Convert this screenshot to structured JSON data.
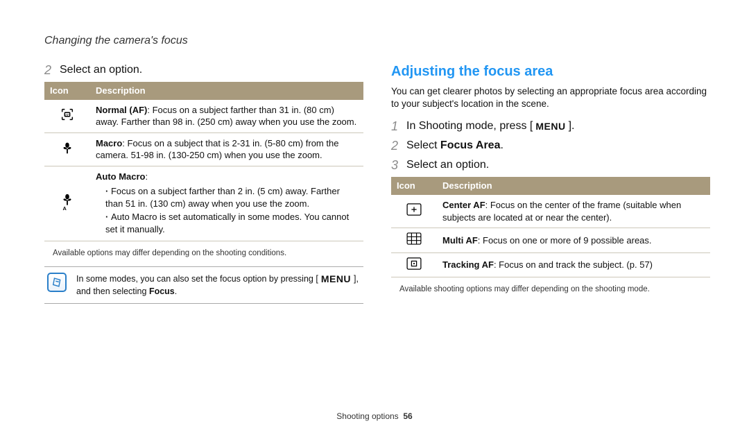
{
  "breadcrumb": "Changing the camera's focus",
  "left": {
    "step_num": "2",
    "step_text": "Select an option.",
    "table": {
      "headers": [
        "Icon",
        "Description"
      ],
      "rows": [
        {
          "icon": "normal-af",
          "title": "Normal (AF)",
          "body": ": Focus on a subject farther than 31 in. (80 cm) away. Farther than 98 in. (250 cm) away when you use the zoom."
        },
        {
          "icon": "macro",
          "title": "Macro",
          "body": ": Focus on a subject that is 2-31 in. (5-80 cm) from the camera. 51-98 in. (130-250 cm) when you use the zoom."
        },
        {
          "icon": "auto-macro",
          "title": "Auto Macro",
          "body": ":",
          "bullets": [
            "Focus on a subject farther than 2 in. (5 cm) away. Farther than 51 in. (130 cm) away when you use the zoom.",
            "Auto Macro is set automatically in some modes. You cannot set it manually."
          ]
        }
      ]
    },
    "caption": "Available options may differ depending on the shooting conditions.",
    "note_pre": "In some modes, you can also set the focus option by pressing [",
    "note_menu": "MENU",
    "note_mid": "], and then selecting ",
    "note_bold": "Focus",
    "note_post": "."
  },
  "right": {
    "title": "Adjusting the focus area",
    "intro": "You can get clearer photos by selecting an appropriate focus area according to your subject's location in the scene.",
    "steps": [
      {
        "num": "1",
        "pre": "In Shooting mode, press [",
        "menu": "MENU",
        "post": "]."
      },
      {
        "num": "2",
        "pre": "Select ",
        "bold": "Focus Area",
        "post": "."
      },
      {
        "num": "3",
        "pre": "Select an option."
      }
    ],
    "table": {
      "headers": [
        "Icon",
        "Description"
      ],
      "rows": [
        {
          "icon": "center-af",
          "title": "Center AF",
          "body": ": Focus on the center of the frame (suitable when subjects are located at or near the center)."
        },
        {
          "icon": "multi-af",
          "title": "Multi AF",
          "body": ": Focus on one or more of 9 possible areas."
        },
        {
          "icon": "tracking-af",
          "title": "Tracking AF",
          "body": ": Focus on and track the subject. (p. 57)"
        }
      ]
    },
    "caption": "Available shooting options may differ depending on the shooting mode."
  },
  "footer_section": "Shooting options",
  "footer_page": "56"
}
